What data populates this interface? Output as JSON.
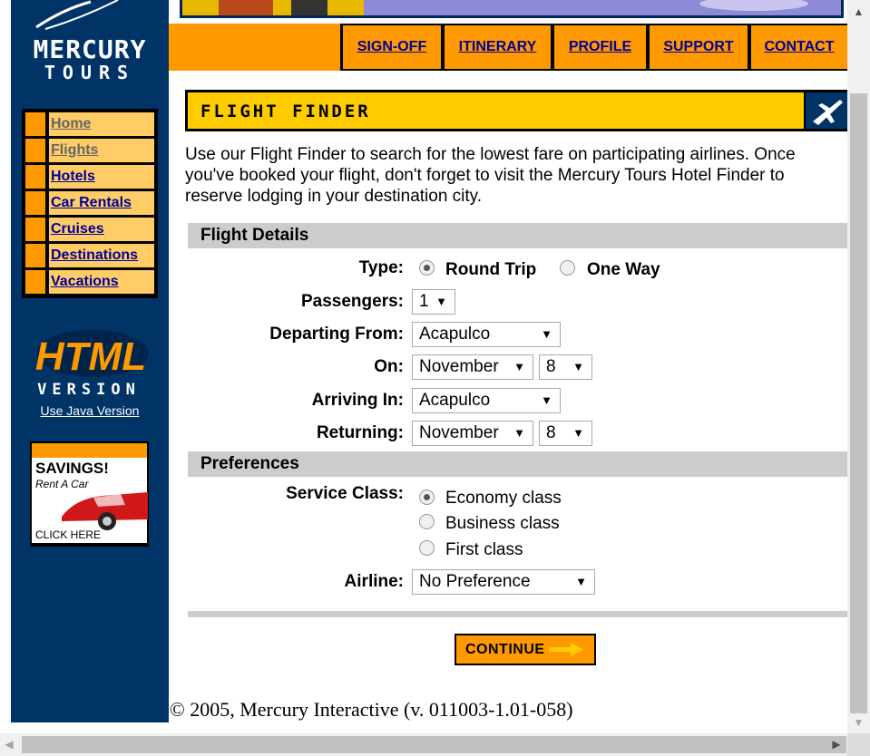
{
  "logo": {
    "line1": "MERCURY",
    "line2": "TOURS"
  },
  "left_nav": [
    {
      "label": "Home",
      "visited": true
    },
    {
      "label": "Flights",
      "visited": true
    },
    {
      "label": "Hotels",
      "visited": false
    },
    {
      "label": "Car Rentals",
      "visited": false
    },
    {
      "label": "Cruises",
      "visited": false
    },
    {
      "label": "Destinations",
      "visited": false
    },
    {
      "label": "Vacations",
      "visited": false
    }
  ],
  "html_version": {
    "line1": "HTML",
    "line2": "VERSION",
    "java_link": "Use Java Version"
  },
  "ad": {
    "title": "SAVINGS!",
    "subtitle": "Rent A Car",
    "cta": "CLICK HERE"
  },
  "top_nav": [
    "SIGN-OFF",
    "ITINERARY",
    "PROFILE",
    "SUPPORT",
    "CONTACT"
  ],
  "header": {
    "title": "FLIGHT FINDER"
  },
  "intro": "Use our Flight Finder to search for the lowest fare on participating airlines. Once you've booked your flight, don't forget to visit the Mercury Tours Hotel Finder to reserve lodging in your destination city.",
  "flight_details": {
    "section_title": "Flight Details",
    "type_label": "Type:",
    "type_options": [
      {
        "label": "Round Trip",
        "checked": true
      },
      {
        "label": "One Way",
        "checked": false
      }
    ],
    "passengers_label": "Passengers:",
    "passengers_value": "1",
    "departing_label": "Departing From:",
    "departing_value": "Acapulco",
    "on_label": "On:",
    "on_month": "November",
    "on_day": "8",
    "arriving_label": "Arriving In:",
    "arriving_value": "Acapulco",
    "returning_label": "Returning:",
    "returning_month": "November",
    "returning_day": "8"
  },
  "preferences": {
    "section_title": "Preferences",
    "service_label": "Service Class:",
    "service_options": [
      {
        "label": "Economy class",
        "checked": true
      },
      {
        "label": "Business class",
        "checked": false
      },
      {
        "label": "First class",
        "checked": false
      }
    ],
    "airline_label": "Airline:",
    "airline_value": "No Preference"
  },
  "continue_label": "CONTINUE",
  "footer": "© 2005, Mercury Interactive (v. 011003-1.01-058)",
  "colors": {
    "navy": "#003366",
    "orange": "#FF9900",
    "yellow": "#FFCC00",
    "link": "#000099"
  }
}
